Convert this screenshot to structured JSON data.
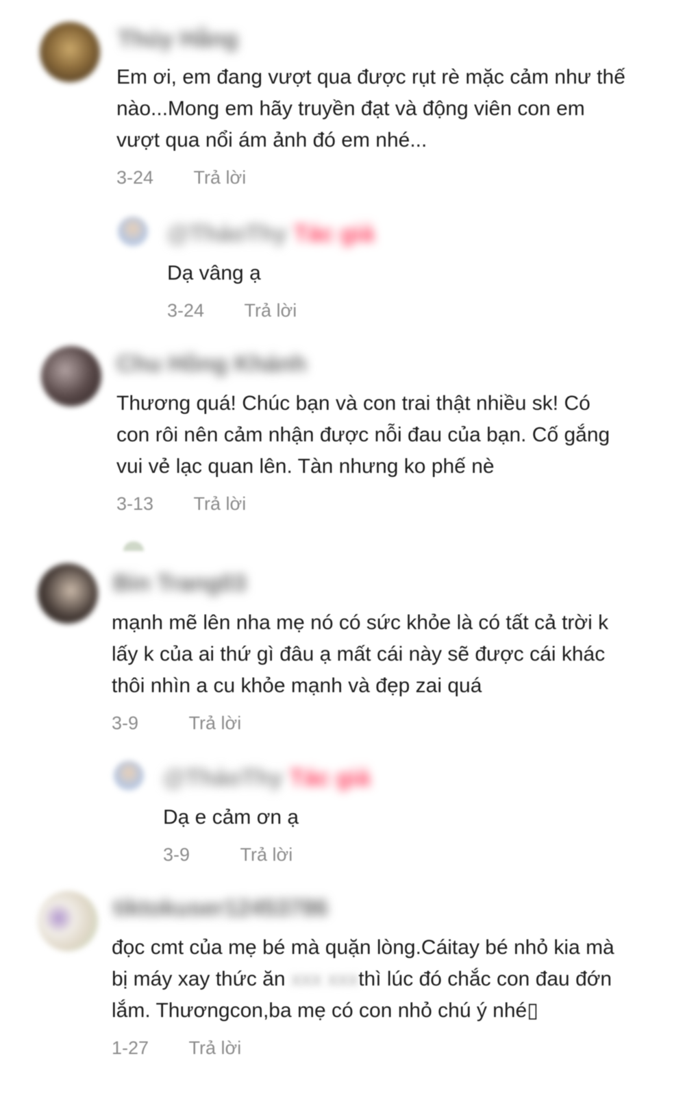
{
  "comments": [
    {
      "author": "Thúy Hằng",
      "text": "Em ơi, em đang vượt qua được rụt rè mặc cảm như thế\nnào...Mong em hãy truyền đạt và động viên con em\nvượt qua nổi ám ảnh đó em nhé...",
      "date": "3-24",
      "reply_label": "Trả lời",
      "avatar_color": "#8a6a3a",
      "reply": {
        "author": "@ThảoThy",
        "tag": "Tác giả",
        "text": "Dạ vâng ạ",
        "date": "3-24",
        "reply_label": "Trả lời"
      }
    },
    {
      "author": "Chu Hồng Khánh",
      "text": "Thương quá! Chúc bạn và con trai thật nhiều sk! Có\ncon rôi nên cảm nhận được nỗi đau của bạn. Cố gắng\nvui vẻ lạc quan lên. Tàn nhưng ko phế nè",
      "date": "3-13",
      "reply_label": "Trả lời",
      "avatar_color": "#5a4a4a"
    },
    {
      "author": "Bin Trang03",
      "text": "mạnh mẽ lên nha mẹ nó có sức khỏe là có tất cả trời k\nlấy k của ai thứ gì đâu ạ mất cái này sẽ được cái khác\nthôi nhìn a cu khỏe mạnh và đẹp zai quá",
      "date": "3-9",
      "reply_label": "Trả lời",
      "avatar_color": "#4a3f3a",
      "reply": {
        "author": "@ThảoThy",
        "tag": "Tác giả",
        "text": "Dạ e cảm ơn ạ",
        "date": "3-9",
        "reply_label": "Trả lời"
      }
    },
    {
      "author": "tiktokuser12453786",
      "text_before": "đọc cmt của mẹ bé mà quặn lòng.Cáitay bé nhỏ kia mà\nbị máy xay thức ăn ",
      "text_blur": "xxx xxx",
      "text_after": "thì lúc đó chắc con đau đớn\nlắm. Thươngcon,ba mẹ có con nhỏ chú ý nhé▯",
      "date": "1-27",
      "reply_label": "Trả lời",
      "avatar_color": "#e6dccf"
    }
  ]
}
